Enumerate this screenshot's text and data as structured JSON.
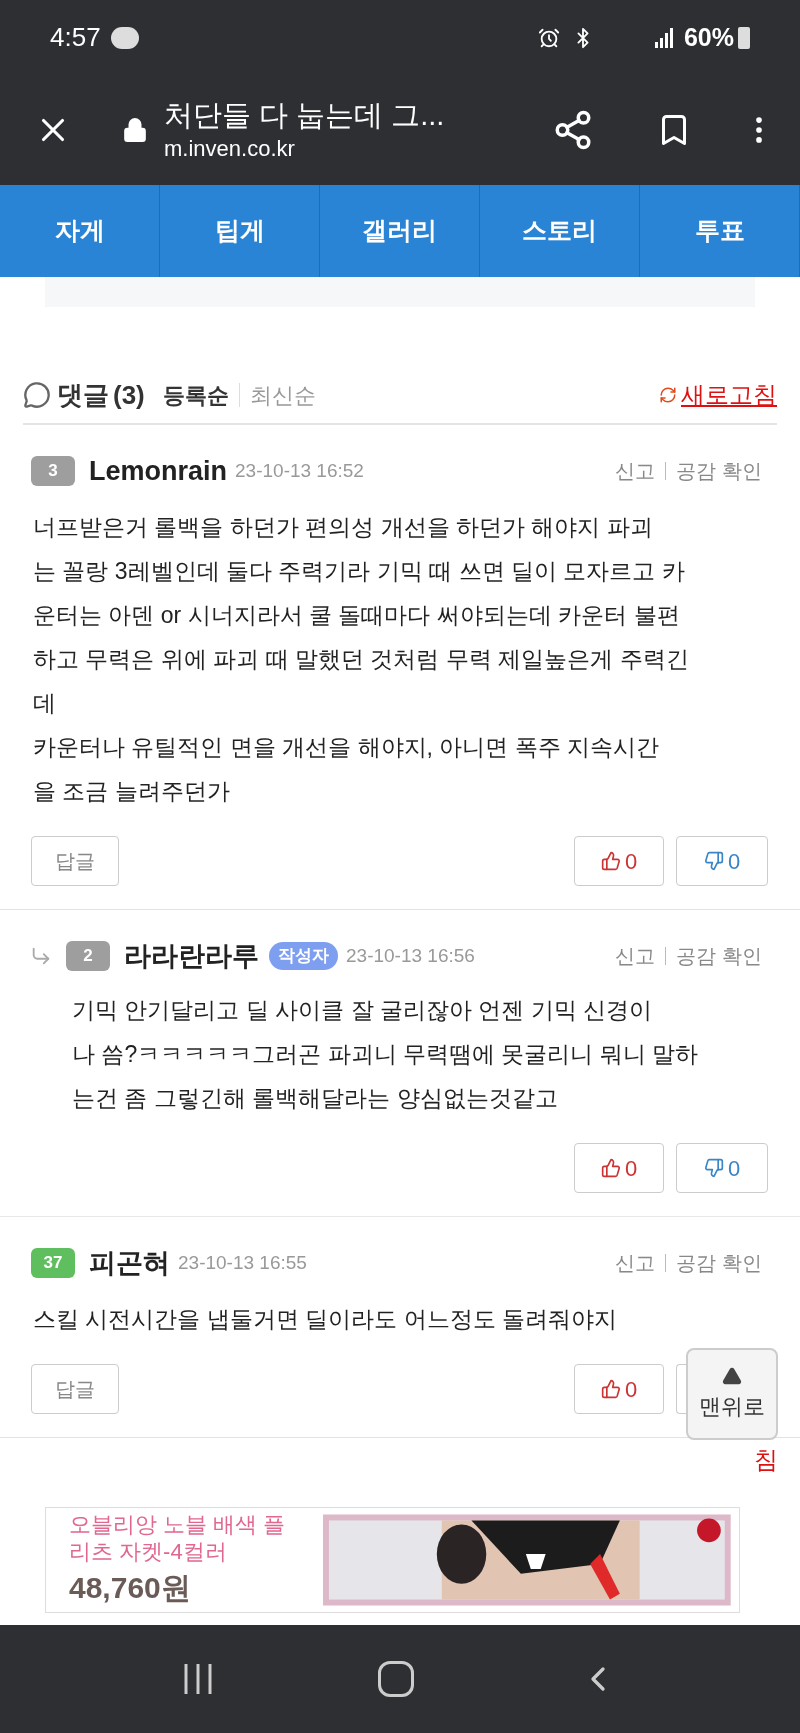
{
  "status_bar": {
    "time": "4:57",
    "battery": "60%"
  },
  "browser": {
    "title": "처단들 다 눕는데 그...",
    "url": "m.inven.co.kr"
  },
  "tabs": [
    {
      "label": "자게"
    },
    {
      "label": "팁게"
    },
    {
      "label": "갤러리"
    },
    {
      "label": "스토리"
    },
    {
      "label": "투표"
    }
  ],
  "comments_header": {
    "title": "댓글",
    "count": "(3)",
    "sort": [
      {
        "label": "등록순",
        "selected": true
      },
      {
        "label": "최신순",
        "selected": false
      }
    ],
    "refresh": "새로고침"
  },
  "comments": [
    {
      "reply": false,
      "badge": {
        "label": "3",
        "color": "#9e9e9e"
      },
      "author": "Lemonrain",
      "date": "23-10-13 16:52",
      "actions": [
        "신고",
        "공감 확인"
      ],
      "body": "너프받은거 롤백을 하던가 편의성 개선을 하던가 해야지 파괴\n는 꼴랑 3레벨인데 둘다 주력기라 기믹 때 쓰면 딜이 모자르고 카\n운터는 아덴 or 시너지라서 쿨 돌때마다 써야되는데 카운터 불편\n하고 무력은 위에 파괴 때 말했던 것처럼 무력 제일높은게 주력긴\n데\n카운터나 유틸적인 면을 개선을 해야지, 아니면 폭주 지속시간\n을 조금 늘려주던가",
      "reply_button": "답글",
      "like": "0",
      "dislike": "0"
    },
    {
      "reply": true,
      "badge": {
        "label": "2",
        "color": "#9e9e9e"
      },
      "author": "라라란라루",
      "tag": "작성자",
      "date": "23-10-13 16:56",
      "actions": [
        "신고",
        "공감 확인"
      ],
      "body": "기믹 안기달리고 딜 사이클 잘 굴리잖아 언젠 기믹 신경이\n나 씀?ㅋㅋㅋㅋㅋ그러곤 파괴니 무력땜에 못굴리니 뭐니 말하\n는건 좀 그렇긴해 롤백해달라는 양심없는것같고",
      "like": "0",
      "dislike": "0"
    },
    {
      "reply": false,
      "badge": {
        "label": "37",
        "color": "#5fbf5f"
      },
      "author": "피곤혀",
      "date": "23-10-13 16:55",
      "actions": [
        "신고",
        "공감 확인"
      ],
      "body": "스킬 시전시간을 냅둘거면 딜이라도 어느정도 돌려줘야지",
      "reply_button": "답글",
      "like": "0"
    }
  ],
  "covered_text": "침",
  "scroll_top": {
    "label": "맨위로"
  },
  "ad": {
    "title": "오블리앙 노블 배색 플\n리츠 자켓-4컬러",
    "price": "48,760원"
  }
}
